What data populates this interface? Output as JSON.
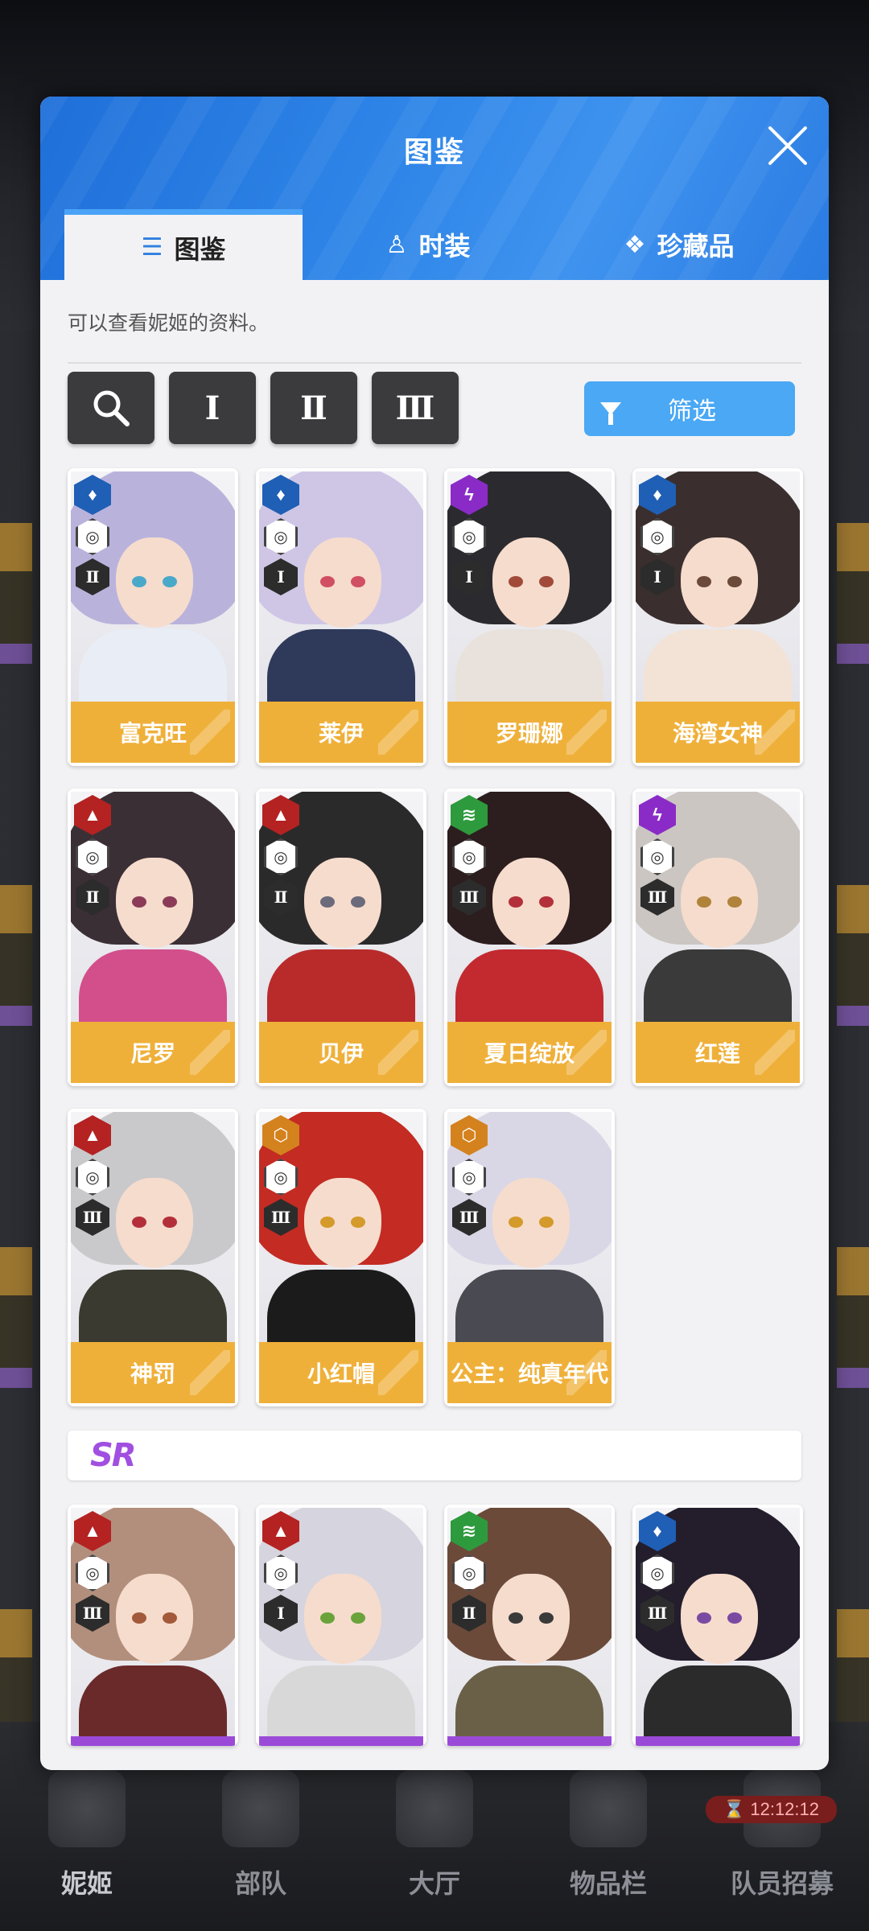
{
  "background_nav": {
    "items": [
      {
        "label": "妮姬",
        "active": true
      },
      {
        "label": "部队",
        "active": false
      },
      {
        "label": "大厅",
        "active": false
      },
      {
        "label": "物品栏",
        "active": false
      },
      {
        "label": "队员招募",
        "active": false
      }
    ],
    "timer": "12:12:12"
  },
  "modal": {
    "title": "图鉴",
    "tabs": [
      {
        "label": "图鉴",
        "icon": "list-icon",
        "active": true
      },
      {
        "label": "时装",
        "icon": "dress-icon",
        "active": false
      },
      {
        "label": "珍藏品",
        "icon": "treasure-icon",
        "active": false
      }
    ],
    "description": "可以查看妮姬的资料。",
    "toolbar": {
      "search_icon": "search-icon",
      "burst_filters": [
        "Ⅰ",
        "Ⅱ",
        "Ⅲ"
      ],
      "filter_label": "筛选"
    },
    "ssr_cards": [
      {
        "name": "富克旺",
        "element": "water",
        "element_color": "#1f5fb5",
        "burst": "Ⅱ",
        "hair": "#b9b3dc",
        "eye": "#4aa9c9",
        "outfit": "#e9eef6"
      },
      {
        "name": "莱伊",
        "element": "water",
        "element_color": "#1f5fb5",
        "burst": "Ⅰ",
        "hair": "#cfc6e6",
        "eye": "#d04f61",
        "outfit": "#2f3a5a"
      },
      {
        "name": "罗珊娜",
        "element": "electric",
        "element_color": "#8a2bc7",
        "burst": "Ⅰ",
        "hair": "#2b2b2f",
        "eye": "#a14a3a",
        "outfit": "#e9e2dc"
      },
      {
        "name": "海湾女神",
        "element": "water",
        "element_color": "#1f5fb5",
        "burst": "Ⅰ",
        "hair": "#3a2f2e",
        "eye": "#6b4a3a",
        "outfit": "#f3e3d6"
      },
      {
        "name": "尼罗",
        "element": "fire",
        "element_color": "#b42222",
        "burst": "Ⅱ",
        "hair": "#3b2f36",
        "eye": "#8b3b58",
        "outfit": "#d34f8b"
      },
      {
        "name": "贝伊",
        "element": "fire",
        "element_color": "#b42222",
        "burst": "Ⅱ",
        "hair": "#2b2a2b",
        "eye": "#6b6b7b",
        "outfit": "#b92b2b"
      },
      {
        "name": "夏日绽放",
        "element": "wind",
        "element_color": "#2e9a3e",
        "burst": "Ⅲ",
        "hair": "#2c1e1e",
        "eye": "#b3303a",
        "outfit": "#c22a2f"
      },
      {
        "name": "红莲",
        "element": "electric",
        "element_color": "#8a2bc7",
        "burst": "Ⅲ",
        "hair": "#cbc6c2",
        "eye": "#b0833a",
        "outfit": "#3a3a3a"
      },
      {
        "name": "神罚",
        "element": "fire",
        "element_color": "#b42222",
        "burst": "Ⅲ",
        "hair": "#c9c9cc",
        "eye": "#b3303a",
        "outfit": "#3a3a30"
      },
      {
        "name": "小红帽",
        "element": "iron",
        "element_color": "#d4821e",
        "burst": "Ⅲ",
        "hair": "#c32b23",
        "eye": "#d49a2a",
        "outfit": "#1b1b1b"
      },
      {
        "name": "公主：纯真年代",
        "element": "iron",
        "element_color": "#d4821e",
        "burst": "Ⅲ",
        "hair": "#d9d7e6",
        "eye": "#d49a2a",
        "outfit": "#4a4a52"
      }
    ],
    "sr_label": "SR",
    "sr_cards": [
      {
        "element": "fire",
        "element_color": "#b42222",
        "burst": "Ⅲ",
        "hair": "#b28f7c",
        "eye": "#a35a3a",
        "outfit": "#6b2a2a"
      },
      {
        "element": "fire",
        "element_color": "#b42222",
        "burst": "Ⅰ",
        "hair": "#d6d4de",
        "eye": "#6aa33a",
        "outfit": "#d8d8d8"
      },
      {
        "element": "wind",
        "element_color": "#2e9a3e",
        "burst": "Ⅱ",
        "hair": "#6b4a3a",
        "eye": "#3a3a3a",
        "outfit": "#6a6048"
      },
      {
        "element": "water",
        "element_color": "#1f5fb5",
        "burst": "Ⅲ",
        "hair": "#231d2c",
        "eye": "#7a4aa3",
        "outfit": "#2b2b2b"
      }
    ]
  }
}
